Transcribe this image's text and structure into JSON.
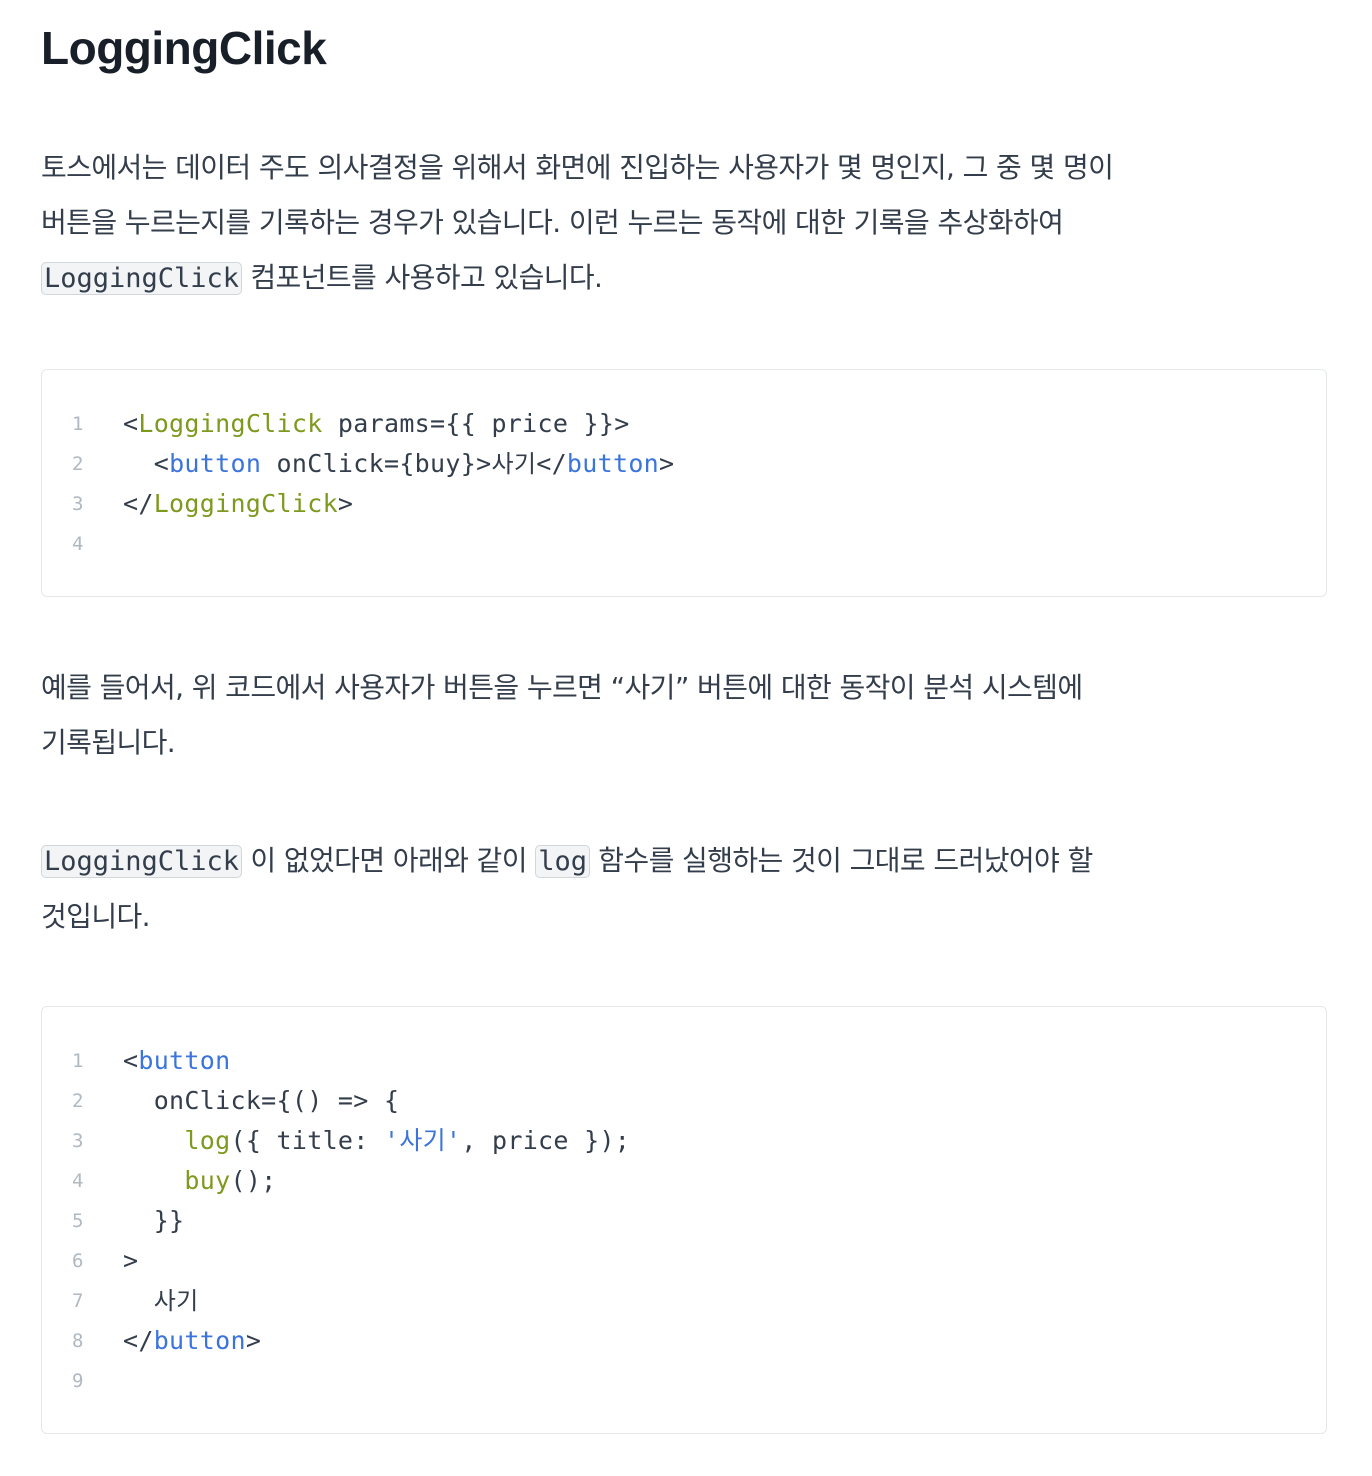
{
  "title": "LoggingClick",
  "paragraphs": {
    "p1": {
      "line1": "토스에서는 데이터 주도 의사결정을 위해서 화면에 진입하는 사용자가 몇 명인지, 그 중 몇 명이",
      "line2": "버튼을 누르는지를 기록하는 경우가 있습니다. 이런 누르는 동작에 대한 기록을 추상화하여",
      "line3_code": "LoggingClick",
      "line3_text": " 컴포넌트를 사용하고 있습니다."
    },
    "p2": {
      "line1": "예를 들어서, 위 코드에서 사용자가 버튼을 누르면 “사기” 버튼에 대한 동작이 분석 시스템에",
      "line2": "기록됩니다."
    },
    "p3": {
      "line1_code1": "LoggingClick",
      "line1_text1": " 이 없었다면 아래와 같이 ",
      "line1_code2": "log",
      "line1_text2": " 함수를 실행하는 것이 그대로 드러났어야 할",
      "line2": "것입니다."
    }
  },
  "code_block_1": {
    "line_numbers": [
      "1",
      "2",
      "3",
      "4"
    ],
    "lines": [
      [
        {
          "t": "<",
          "k": "plain"
        },
        {
          "t": "LoggingClick",
          "k": "tag"
        },
        {
          "t": " params={{ price }}>",
          "k": "plain"
        }
      ],
      [
        {
          "t": "  <",
          "k": "plain"
        },
        {
          "t": "button",
          "k": "html"
        },
        {
          "t": " onClick={buy}>",
          "k": "plain"
        },
        {
          "t": "사기",
          "k": "kr"
        },
        {
          "t": "</",
          "k": "plain"
        },
        {
          "t": "button",
          "k": "html"
        },
        {
          "t": ">",
          "k": "plain"
        }
      ],
      [
        {
          "t": "</",
          "k": "plain"
        },
        {
          "t": "LoggingClick",
          "k": "tag"
        },
        {
          "t": ">",
          "k": "plain"
        }
      ],
      []
    ]
  },
  "code_block_2": {
    "line_numbers": [
      "1",
      "2",
      "3",
      "4",
      "5",
      "6",
      "7",
      "8",
      "9"
    ],
    "lines": [
      [
        {
          "t": "<",
          "k": "plain"
        },
        {
          "t": "button",
          "k": "html"
        }
      ],
      [
        {
          "t": "  onClick={() => {",
          "k": "plain"
        }
      ],
      [
        {
          "t": "    ",
          "k": "plain"
        },
        {
          "t": "log",
          "k": "fn"
        },
        {
          "t": "({ title: ",
          "k": "plain"
        },
        {
          "t": "'사기'",
          "k": "str"
        },
        {
          "t": ", price });",
          "k": "plain"
        }
      ],
      [
        {
          "t": "    ",
          "k": "plain"
        },
        {
          "t": "buy",
          "k": "fn"
        },
        {
          "t": "();",
          "k": "plain"
        }
      ],
      [
        {
          "t": "  }}",
          "k": "plain"
        }
      ],
      [
        {
          "t": ">",
          "k": "plain"
        }
      ],
      [
        {
          "t": "  ",
          "k": "plain"
        },
        {
          "t": "사기",
          "k": "kr"
        }
      ],
      [
        {
          "t": "</",
          "k": "plain"
        },
        {
          "t": "button",
          "k": "html"
        },
        {
          "t": ">",
          "k": "plain"
        }
      ],
      []
    ]
  }
}
